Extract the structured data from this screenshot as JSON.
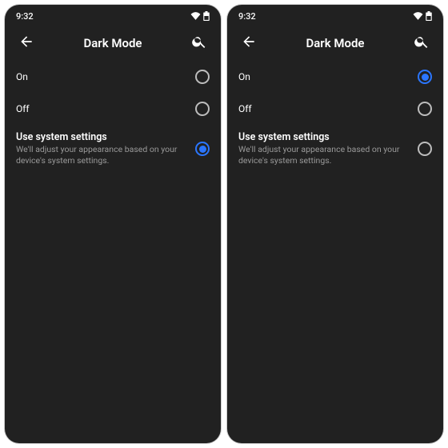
{
  "screens": [
    {
      "status": {
        "time": "9:32"
      },
      "header": {
        "title": "Dark Mode"
      },
      "options": [
        {
          "label": "On",
          "sub": "",
          "bold": false,
          "selected": false
        },
        {
          "label": "Off",
          "sub": "",
          "bold": false,
          "selected": false
        },
        {
          "label": "Use system settings",
          "sub": "We'll adjust your appearance based on your device's system settings.",
          "bold": true,
          "selected": true
        }
      ]
    },
    {
      "status": {
        "time": "9:32"
      },
      "header": {
        "title": "Dark Mode"
      },
      "options": [
        {
          "label": "On",
          "sub": "",
          "bold": false,
          "selected": true
        },
        {
          "label": "Off",
          "sub": "",
          "bold": false,
          "selected": false
        },
        {
          "label": "Use system settings",
          "sub": "We'll adjust your appearance based on your device's system settings.",
          "bold": true,
          "selected": false
        }
      ]
    }
  ]
}
